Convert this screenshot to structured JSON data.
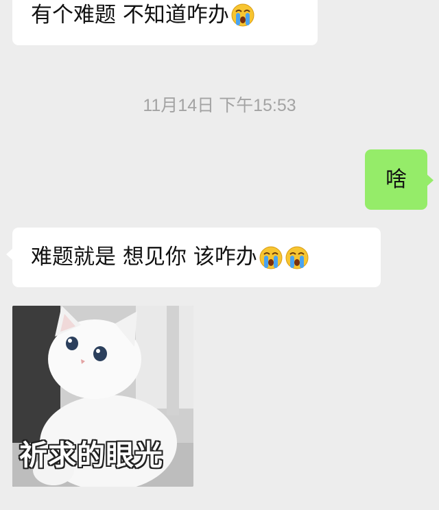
{
  "messages": [
    {
      "side": "in",
      "text": "有个难题 不知道咋办",
      "emoji": "loudly-crying-face",
      "emoji_count": 1
    },
    {
      "side": "out",
      "text": "啥"
    },
    {
      "side": "in",
      "text": "难题就是 想见你 该咋办",
      "emoji": "loudly-crying-face",
      "emoji_count": 2
    }
  ],
  "timestamp": "11月14日 下午15:53",
  "sticker": {
    "caption": "祈求的眼光",
    "subject": "white-kitten"
  },
  "colors": {
    "background": "#ededed",
    "incoming_bubble": "#ffffff",
    "outgoing_bubble": "#95ec69",
    "timestamp": "#a3a3a3"
  }
}
